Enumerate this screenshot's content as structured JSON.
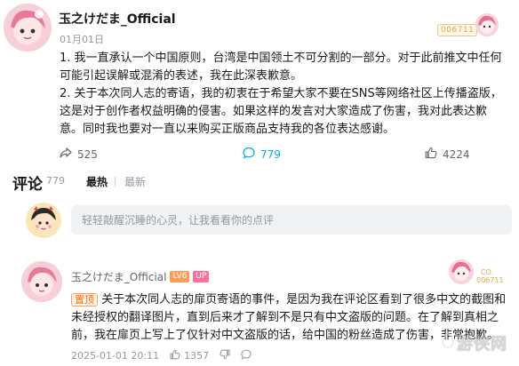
{
  "post": {
    "author_name": "玉之けだま_Official",
    "date": "01月01日",
    "fan_badge": "006711",
    "paragraphs": [
      "1. 我一直承认一个中国原则，台湾是中国领土不可分割的一部分。对于此前推文中任何可能引起误解或混淆的表述，我在此深表歉意。",
      "2. 关于本次同人志的寄语，我的初衷在于希望大家不要在SNS等网络社区上传播盗版，这是对于创作者权益明确的侵害。如果这样的发言对大家造成了伤害，我对此表达歉意。同时我也要对一直以来购买正版商品支持我的各位表达感谢。"
    ],
    "stats": {
      "forwards": "525",
      "comments": "779",
      "likes": "4224"
    }
  },
  "comments_section": {
    "title": "评论",
    "count": "779",
    "sort_hot": "最热",
    "sort_new": "最新",
    "input_placeholder": "轻轻敲醒沉睡的心灵，让我看看你的点评"
  },
  "comment": {
    "author_name": "玉之けだま_Official",
    "level": "LV6",
    "up_label": "UP",
    "pin_label": "置顶",
    "text": "关于本次同人志的扉页寄语的事件，是因为我在评论区看到了很多中文的截图和未经授权的翻译图片，直到后来才了解到不是只有中文盗版的问题。在了解到真相之前，我在扉页上写上了仅针对中文盗版的话，给中国的粉丝造成了伤害，非常抱歉。",
    "time": "2025-01-01 20:11",
    "likes": "1357",
    "fan_badge": "CO. 006711"
  },
  "watermark": "游侠网",
  "colors": {
    "comment_count_blue": "#00aeec",
    "pin_orange": "#ff6a00",
    "up_pink": "#fb7299"
  }
}
